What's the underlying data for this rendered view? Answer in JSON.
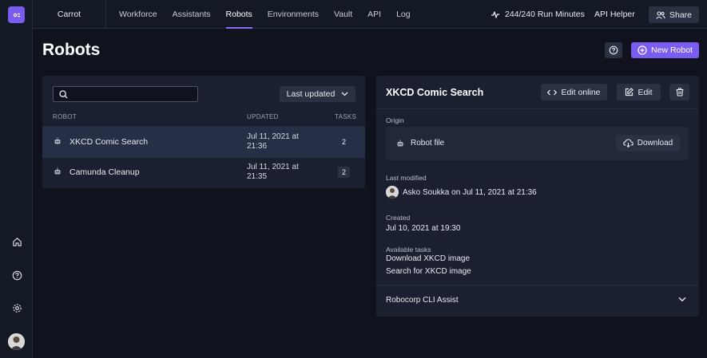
{
  "topbar": {
    "org": "Carrot",
    "nav": [
      "Workforce",
      "Assistants",
      "Robots",
      "Environments",
      "Vault",
      "API",
      "Log"
    ],
    "active_nav": "Robots",
    "run_minutes": "244/240 Run Minutes",
    "api_helper": "API Helper",
    "share": "Share"
  },
  "page": {
    "title": "Robots",
    "new_robot": "New Robot"
  },
  "list": {
    "search_placeholder": "",
    "sort_label": "Last updated",
    "columns": {
      "robot": "ROBOT",
      "updated": "UPDATED",
      "tasks": "TASKS"
    },
    "rows": [
      {
        "name": "XKCD Comic Search",
        "updated": "Jul 11, 2021 at 21:36",
        "tasks": "2"
      },
      {
        "name": "Camunda Cleanup",
        "updated": "Jul 11, 2021 at 21:35",
        "tasks": "2"
      }
    ]
  },
  "detail": {
    "title": "XKCD Comic Search",
    "edit_online": "Edit online",
    "edit": "Edit",
    "origin_label": "Origin",
    "origin_value": "Robot file",
    "download": "Download",
    "last_modified_label": "Last modified",
    "last_modified_user": "Asko Soukka",
    "last_modified_on": "on",
    "last_modified_date": "Jul 11, 2021 at 21:36",
    "created_label": "Created",
    "created_date": "Jul 10, 2021 at 19:30",
    "tasks_label": "Available tasks",
    "tasks": [
      "Download XKCD image",
      "Search for XKCD image"
    ],
    "cli_assist": "Robocorp CLI Assist"
  },
  "colors": {
    "accent": "#7b5cf0",
    "background": "#10131e",
    "panel": "#1a2030",
    "selected_row": "#253046"
  }
}
